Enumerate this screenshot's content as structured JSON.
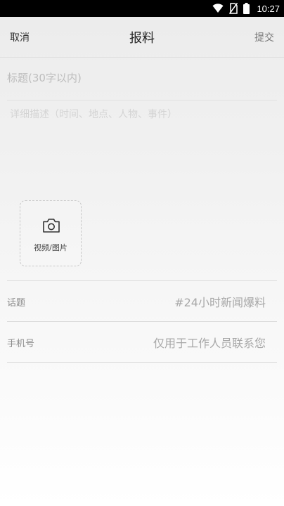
{
  "status_bar": {
    "time": "10:27",
    "icons": [
      "wifi-icon",
      "no-sim-icon",
      "battery-icon"
    ]
  },
  "nav": {
    "cancel_label": "取消",
    "title": "报料",
    "submit_label": "提交"
  },
  "form": {
    "title_placeholder": "标题(30字以内)",
    "description_placeholder": "详细描述（时间、地点、人物、事件）",
    "upload_label": "视频/图片",
    "topic": {
      "label": "话题",
      "value": "#24小时新闻爆料"
    },
    "phone": {
      "label": "手机号",
      "placeholder": "仅用于工作人员联系您"
    }
  },
  "colors": {
    "status_bar": "#000000",
    "text_primary": "#222222",
    "placeholder": "#bdbdbd",
    "divider": "#dcdcdc"
  }
}
